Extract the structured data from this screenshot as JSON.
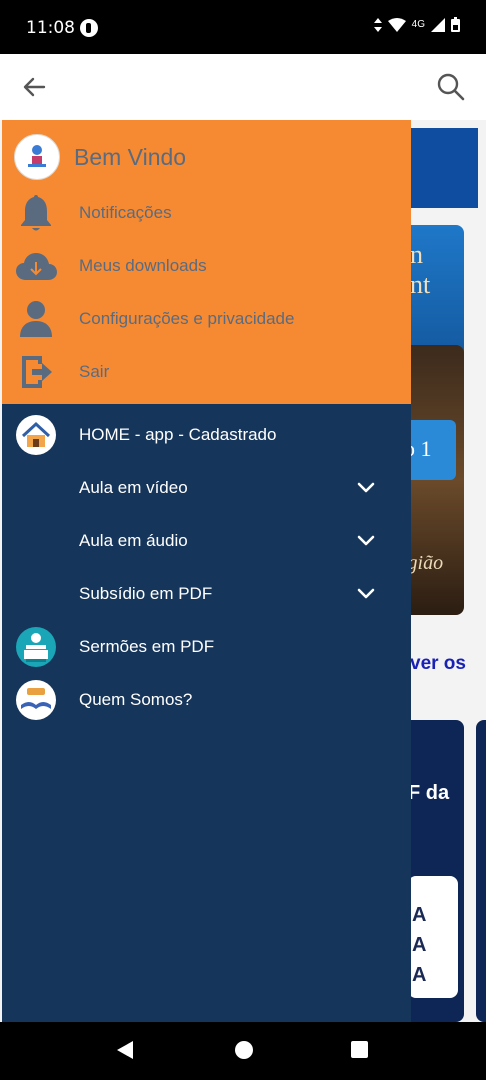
{
  "status_bar": {
    "time": "11:08",
    "network": "4G"
  },
  "app_bar": {
    "back_icon": "arrow-left-icon",
    "search_icon": "search-icon"
  },
  "drawer": {
    "header_color": "#f58a33",
    "body_color": "#16355a",
    "welcome_text": "Bem Vindo",
    "header_items": [
      {
        "label": "Notificações",
        "icon": "bell-icon"
      },
      {
        "label": "Meus downloads",
        "icon": "cloud-download-icon"
      },
      {
        "label": "Configurações e privacidade",
        "icon": "user-icon"
      },
      {
        "label": "Sair",
        "icon": "logout-icon"
      }
    ],
    "nav_items": [
      {
        "label": "HOME - app - Cadastrado",
        "icon": "home-icon",
        "expandable": false
      },
      {
        "label": "Aula em vídeo",
        "icon": "",
        "expandable": true
      },
      {
        "label": "Aula em áudio",
        "icon": "",
        "expandable": true
      },
      {
        "label": "Subsídio em PDF",
        "icon": "",
        "expandable": true
      },
      {
        "label": "Sermões em PDF",
        "icon": "preacher-icon",
        "expandable": false
      },
      {
        "label": "Quem Somos?",
        "icon": "book-logo-icon",
        "expandable": false
      }
    ]
  },
  "background": {
    "card1_text": "n\nnt",
    "card2_badge": "o 1",
    "card2_text": "igião",
    "see_all": "ver os",
    "card3_text": "F da",
    "card3_box": "A\nA\nA"
  }
}
